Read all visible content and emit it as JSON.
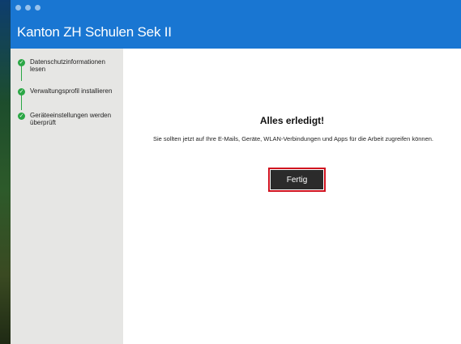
{
  "window": {
    "title": "Kanton ZH Schulen Sek II"
  },
  "sidebar": {
    "steps": [
      {
        "label": "Datenschutzinformationen lesen",
        "status": "completed"
      },
      {
        "label": "Verwaltungsprofil installieren",
        "status": "completed"
      },
      {
        "label": "Geräteeinstellungen werden überprüft",
        "status": "completed"
      }
    ]
  },
  "main": {
    "headline": "Alles erledigt!",
    "message": "Sie sollten jetzt auf Ihre E-Mails, Geräte, WLAN-Verbindungen und Apps für die Arbeit zugreifen können.",
    "done_button_label": "Fertig"
  },
  "icons": {
    "step_check": "check-icon"
  },
  "colors": {
    "titlebar": "#1976d2",
    "sidebar": "#e6e6e4",
    "step_completed": "#2aa745",
    "button_bg": "#2b2b2b",
    "button_focus_ring": "#d0121f"
  }
}
